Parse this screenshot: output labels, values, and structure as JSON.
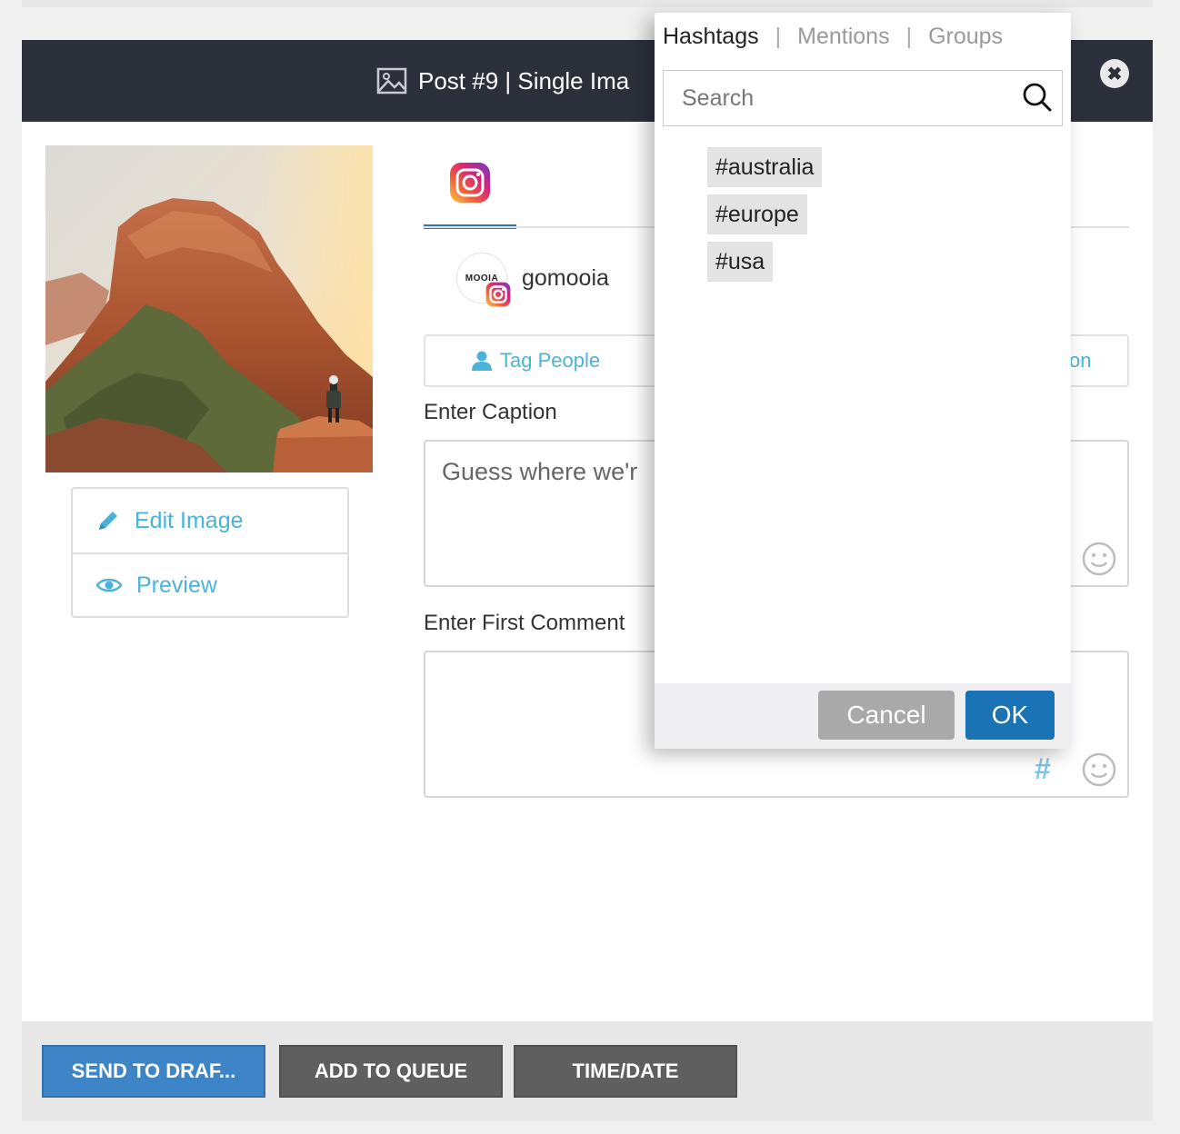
{
  "header": {
    "title": "Post #9 | Single Ima",
    "close_glyph": "✖"
  },
  "image_actions": {
    "edit_label": "Edit Image",
    "preview_label": "Preview"
  },
  "account": {
    "avatar_text": "MOOIA",
    "name": "gomooia"
  },
  "tag_bar": {
    "tag_people_label": "Tag People",
    "right_label_fragment": "on"
  },
  "caption": {
    "label": "Enter Caption",
    "value": "Guess where we'r"
  },
  "first_comment": {
    "label": "Enter First Comment",
    "value": ""
  },
  "footer": {
    "send_draft": "SEND TO DRAF...",
    "add_queue": "ADD TO QUEUE",
    "time_date": "TIME/DATE"
  },
  "popover": {
    "tabs": [
      {
        "label": "Hashtags"
      },
      {
        "label": "Mentions"
      },
      {
        "label": "Groups"
      }
    ],
    "separator": "|",
    "search_placeholder": "Search",
    "hashtags": [
      {
        "label": "#australia"
      },
      {
        "label": "#europe"
      },
      {
        "label": "#usa"
      }
    ],
    "cancel_label": "Cancel",
    "ok_label": "OK"
  },
  "icons": {
    "header": "image-icon",
    "close": "close-icon",
    "edit": "pencil-icon",
    "preview": "eye-icon",
    "instagram": "instagram-icon",
    "person": "person-icon",
    "hashtag": "hashtag-icon",
    "emoji": "smiley-icon",
    "search": "search-icon"
  },
  "colors": {
    "header_bg": "#2b303b",
    "accent": "#4bb3d9",
    "tab_underline": "#2a77b5",
    "send_draft_bg": "#3d85c6",
    "dark_button_bg": "#5f5f5f",
    "cancel_bg": "#a9a9a9",
    "ok_bg": "#1a73b4",
    "hashtag_gray": "#bdbdbd",
    "hashtag_blue": "#7fc6e6"
  }
}
